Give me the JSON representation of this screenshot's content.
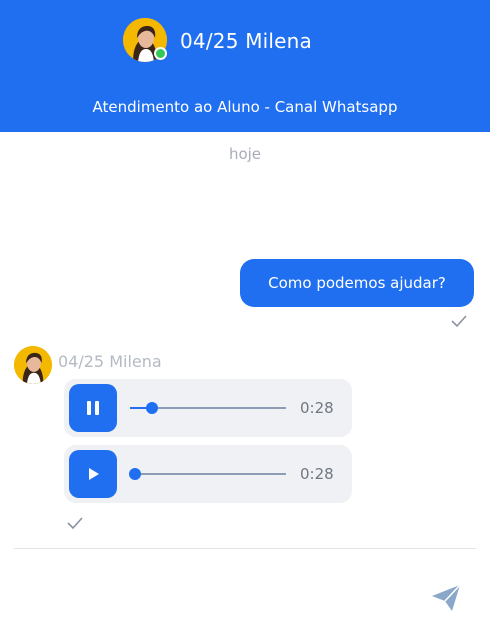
{
  "header": {
    "name": "04/25 Milena",
    "subtitle": "Atendimento ao Aluno - Canal Whatsapp",
    "status": "online"
  },
  "chat": {
    "date_separator": "hoje",
    "outgoing": {
      "text": "Como podemos ajudar?",
      "status": "sent"
    },
    "incoming": {
      "sender": "04/25 Milena",
      "audios": [
        {
          "state": "playing",
          "progress": 0.14,
          "duration": "0:28",
          "button_icon": "pause-icon"
        },
        {
          "state": "paused",
          "progress": 0.03,
          "duration": "0:28",
          "button_icon": "play-icon"
        }
      ],
      "status": "sent"
    }
  },
  "composer": {
    "send_icon": "send-icon"
  },
  "colors": {
    "accent": "#1f6ff0",
    "header_bg": "#1f6ff0",
    "online": "#34c759",
    "audio_bg": "#f0f1f4"
  }
}
